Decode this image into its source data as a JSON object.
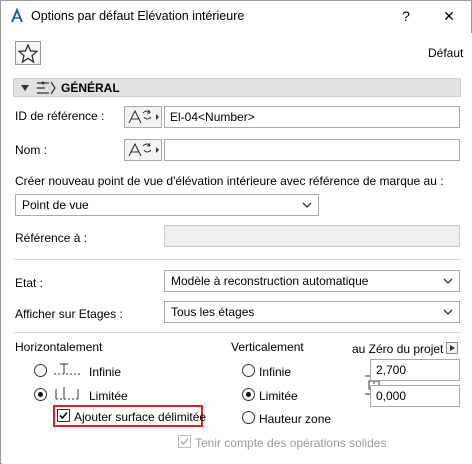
{
  "window": {
    "title": "Options par défaut Elévation intérieure",
    "help_label": "?",
    "close_label": "✕"
  },
  "toolbar": {
    "default_label": "Défaut"
  },
  "section": {
    "title": "GÉNÉRAL"
  },
  "fields": {
    "ref_id_label": "ID de référence :",
    "ref_id_value": "El-04<Number>",
    "name_label": "Nom :",
    "name_value": "",
    "create_label": "Créer nouveau point de vue d'élévation intérieure avec référence de marque au :",
    "create_value": "Point de vue",
    "reference_label": "Référence à :",
    "reference_value": "",
    "state_label": "Etat :",
    "state_value": "Modèle à reconstruction automatique",
    "show_on_floors_label": "Afficher sur Etages :",
    "show_on_floors_value": "Tous les étages"
  },
  "horizontal": {
    "heading": "Horizontalement",
    "infinite_label": "Infinie",
    "limited_label": "Limitée",
    "selected": "limited",
    "add_surface_label": "Ajouter surface délimitée",
    "add_surface_checked": true
  },
  "vertical": {
    "heading": "Verticalement",
    "infinite_label": "Infinie",
    "limited_label": "Limitée",
    "zone_height_label": "Hauteur zone",
    "selected": "limited",
    "zero_label": "au Zéro du projet",
    "top_value": "2,700",
    "bottom_value": "0,000"
  },
  "solid_ops": {
    "label": "Tenir compte des opérations solides",
    "checked": true,
    "enabled": false
  },
  "colors": {
    "highlight": "#e02020",
    "section_bg": "#e1e1e1"
  }
}
